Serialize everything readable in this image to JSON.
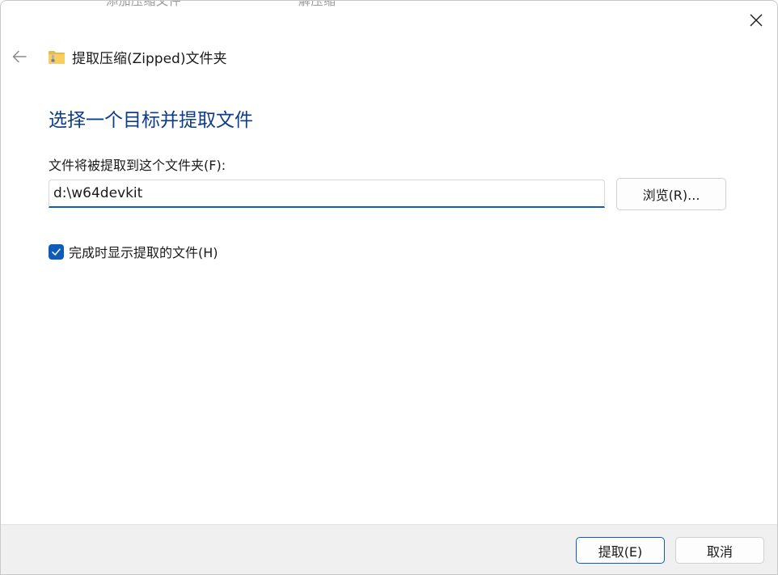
{
  "window": {
    "title": "提取压缩(Zipped)文件夹",
    "bg_peek_left": "添加压缩文件",
    "bg_peek_right": "解压缩"
  },
  "icons": {
    "close": "close-icon",
    "back": "back-arrow-icon",
    "folder": "zipped-folder-icon",
    "checkmark": "checkmark-icon"
  },
  "main": {
    "heading": "选择一个目标并提取文件",
    "field_label": "文件将被提取到这个文件夹(F):",
    "path_value": "d:\\w64devkit",
    "browse_label": "浏览(R)...",
    "show_files_label": "完成时显示提取的文件(H)",
    "show_files_checked": true
  },
  "footer": {
    "extract_label": "提取(E)",
    "cancel_label": "取消"
  },
  "colors": {
    "accent": "#0f5cb8",
    "heading": "#0e3c8c",
    "footer_bg": "#f0f0f0"
  }
}
